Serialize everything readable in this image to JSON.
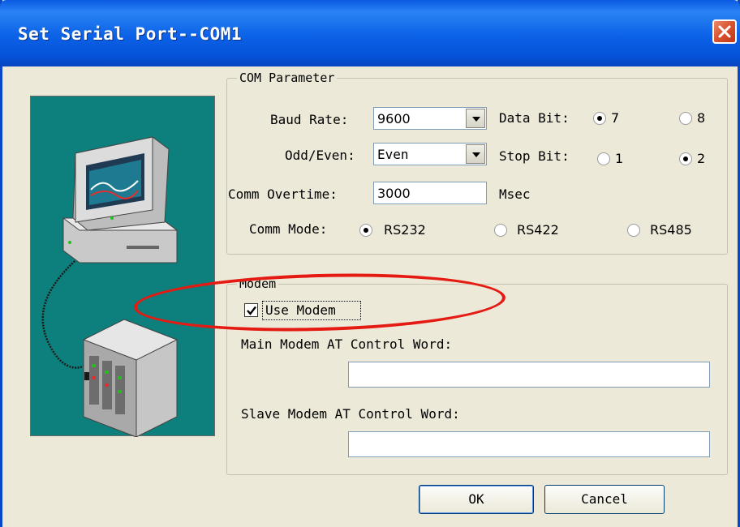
{
  "window": {
    "title": "Set Serial Port--COM1"
  },
  "com_parameter": {
    "group_label": "COM Parameter",
    "baud_rate": {
      "label": "Baud Rate:",
      "value": "9600"
    },
    "odd_even": {
      "label": "Odd/Even:",
      "value": "Even"
    },
    "data_bit": {
      "label": "Data Bit:",
      "options": [
        "7",
        "8"
      ],
      "selected": "7"
    },
    "stop_bit": {
      "label": "Stop Bit:",
      "options": [
        "1",
        "2"
      ],
      "selected": "2"
    },
    "comm_overtime": {
      "label": "Comm Overtime:",
      "value": "3000",
      "unit": "Msec"
    },
    "comm_mode": {
      "label": "Comm Mode:",
      "options": [
        "RS232",
        "RS422",
        "RS485"
      ],
      "selected": "RS232"
    }
  },
  "modem": {
    "group_label": "Modem",
    "use_modem": {
      "label": "Use Modem",
      "checked": true
    },
    "main_at_label": "Main Modem AT Control Word:",
    "main_at_value": "",
    "slave_at_label": "Slave Modem AT Control Word:",
    "slave_at_value": ""
  },
  "buttons": {
    "ok": "OK",
    "cancel": "Cancel"
  },
  "colors": {
    "titlebar": "#0a5ae2",
    "panel": "#0d7f7c",
    "annotation": "#e51b13",
    "dialog": "#ece9d8"
  },
  "icons": [
    "close-icon",
    "dropdown-arrow-icon",
    "computer-icon",
    "plc-device-icon",
    "checkmark-icon"
  ]
}
